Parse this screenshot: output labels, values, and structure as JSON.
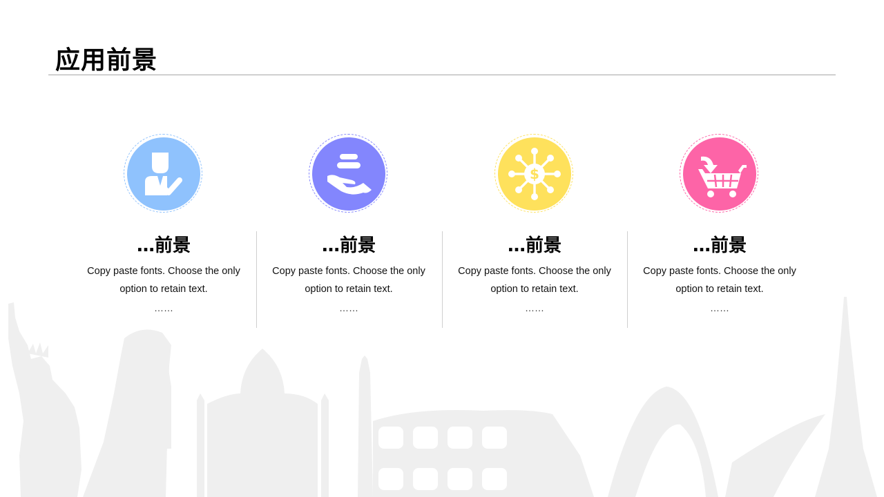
{
  "page": {
    "title": "应用前景"
  },
  "colors": {
    "blue": "#8FC2FD",
    "purple": "#8386FD",
    "yellow": "#FEE15C",
    "pink": "#FD64A7",
    "skyline": "#EFEFEF"
  },
  "cards": [
    {
      "icon": "businessman-check-icon",
      "title": "…前景",
      "body_line1": "Copy paste fonts. Choose the only",
      "body_line2": "option to retain text.",
      "ellipsis": "……"
    },
    {
      "icon": "hand-coins-icon",
      "title": "…前景",
      "body_line1": "Copy paste fonts. Choose the only",
      "body_line2": "option to retain text.",
      "ellipsis": "……"
    },
    {
      "icon": "dollar-network-icon",
      "title": "…前景",
      "body_line1": "Copy paste fonts. Choose the only",
      "body_line2": "option to retain text.",
      "ellipsis": "……"
    },
    {
      "icon": "shopping-cart-icon",
      "title": "…前景",
      "body_line1": "Copy paste fonts. Choose the only",
      "body_line2": "option to retain text.",
      "ellipsis": "……"
    }
  ]
}
